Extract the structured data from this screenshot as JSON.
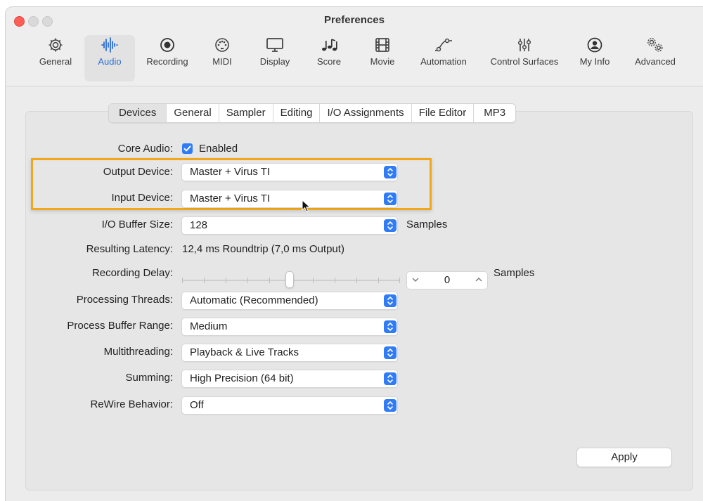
{
  "window": {
    "title": "Preferences"
  },
  "toolbar": {
    "items": [
      {
        "label": "General",
        "icon": "gear-icon"
      },
      {
        "label": "Audio",
        "icon": "waveform-icon",
        "selected": true
      },
      {
        "label": "Recording",
        "icon": "record-icon"
      },
      {
        "label": "MIDI",
        "icon": "midi-port-icon"
      },
      {
        "label": "Display",
        "icon": "monitor-icon"
      },
      {
        "label": "Score",
        "icon": "music-notes-icon"
      },
      {
        "label": "Movie",
        "icon": "film-icon"
      },
      {
        "label": "Automation",
        "icon": "automation-curve-icon"
      },
      {
        "label": "Control Surfaces",
        "icon": "faders-icon"
      },
      {
        "label": "My Info",
        "icon": "user-circle-icon"
      },
      {
        "label": "Advanced",
        "icon": "gears-icon"
      }
    ]
  },
  "tabs": [
    {
      "label": "Devices",
      "selected": true
    },
    {
      "label": "General"
    },
    {
      "label": "Sampler"
    },
    {
      "label": "Editing"
    },
    {
      "label": "I/O Assignments"
    },
    {
      "label": "File Editor"
    },
    {
      "label": "MP3"
    }
  ],
  "settings": {
    "core_audio": {
      "label": "Core Audio:",
      "value": "Enabled",
      "checked": true
    },
    "output_device": {
      "label": "Output Device:",
      "value": "Master + Virus TI"
    },
    "input_device": {
      "label": "Input Device:",
      "value": "Master + Virus TI"
    },
    "io_buffer_size": {
      "label": "I/O Buffer Size:",
      "value": "128",
      "unit": "Samples"
    },
    "resulting_latency": {
      "label": "Resulting Latency:",
      "value": "12,4 ms Roundtrip (7,0 ms Output)"
    },
    "recording_delay": {
      "label": "Recording Delay:",
      "value": "0",
      "unit": "Samples",
      "slider_fraction": 0.5
    },
    "processing_threads": {
      "label": "Processing Threads:",
      "value": "Automatic (Recommended)"
    },
    "process_buffer_range": {
      "label": "Process Buffer Range:",
      "value": "Medium"
    },
    "multithreading": {
      "label": "Multithreading:",
      "value": "Playback & Live Tracks"
    },
    "summing": {
      "label": "Summing:",
      "value": "High Precision (64 bit)"
    },
    "rewire_behavior": {
      "label": "ReWire Behavior:",
      "value": "Off"
    }
  },
  "buttons": {
    "apply": "Apply"
  },
  "colors": {
    "accent": "#2f7cf6",
    "highlight": "#f0a81a",
    "close": "#ff5f57"
  }
}
